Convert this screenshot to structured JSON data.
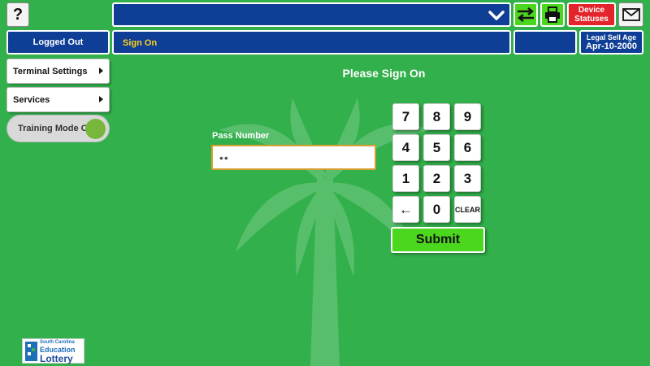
{
  "topbar": {
    "help_label": "?",
    "device_statuses_line1": "Device",
    "device_statuses_line2": "Statuses"
  },
  "status_row": {
    "logged_out": "Logged Out",
    "current_screen": "Sign On",
    "legal_sell_age_label": "Legal Sell Age",
    "legal_sell_age_date": "Apr-10-2000"
  },
  "sidebar": {
    "items": [
      {
        "label": "Terminal Settings"
      },
      {
        "label": "Services"
      }
    ],
    "training_mode": "Training Mode ON"
  },
  "signon": {
    "title": "Please Sign On",
    "pass_label": "Pass Number",
    "pass_value": "••",
    "submit_label": "Submit"
  },
  "keypad": {
    "keys": [
      "7",
      "8",
      "9",
      "4",
      "5",
      "6",
      "1",
      "2",
      "3",
      "←",
      "0",
      "CLEAR"
    ]
  },
  "logo": {
    "line1": "South Carolina",
    "line2": "Education",
    "line3": "Lottery"
  },
  "colors": {
    "background": "#32b04b",
    "bar_blue": "#0f3e96",
    "accent_green": "#4cd71f",
    "alert_red": "#e3242b",
    "screen_name_yellow": "#ffd21a"
  }
}
